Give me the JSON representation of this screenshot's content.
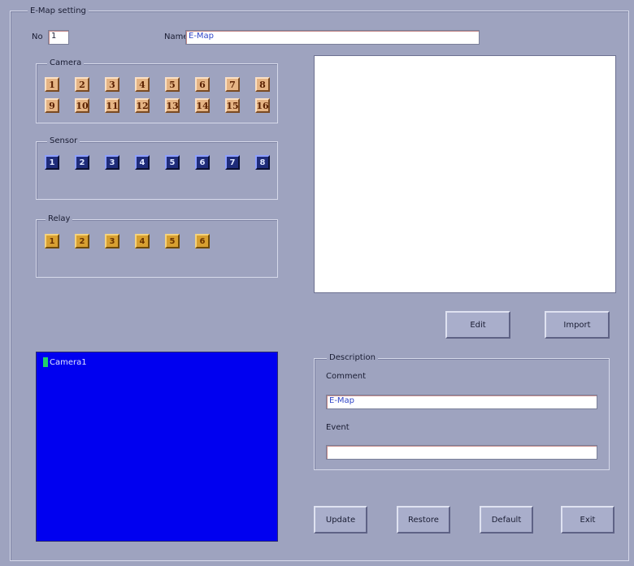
{
  "window": {
    "group_title": "E-Map setting"
  },
  "header": {
    "no_label": "No",
    "no_value": "1",
    "name_label": "Name",
    "name_value": "E-Map"
  },
  "camera": {
    "title": "Camera",
    "items": [
      "1",
      "2",
      "3",
      "4",
      "5",
      "6",
      "7",
      "8",
      "9",
      "10",
      "11",
      "12",
      "13",
      "14",
      "15",
      "16"
    ]
  },
  "sensor": {
    "title": "Sensor",
    "items": [
      "1",
      "2",
      "3",
      "4",
      "5",
      "6",
      "7",
      "8"
    ]
  },
  "relay": {
    "title": "Relay",
    "items": [
      "1",
      "2",
      "3",
      "4",
      "5",
      "6"
    ]
  },
  "map_buttons": {
    "edit": "Edit",
    "import": "Import"
  },
  "tree": {
    "items": [
      {
        "label": "Camera1",
        "icon": "camera-icon"
      }
    ]
  },
  "description": {
    "title": "Description",
    "comment_label": "Comment",
    "comment_value": "E-Map",
    "event_label": "Event",
    "event_value": ""
  },
  "footer": {
    "update": "Update",
    "restore": "Restore",
    "default": "Default",
    "exit": "Exit"
  },
  "colors": {
    "background": "#9ea3bf",
    "camera_tile": "#e5b484",
    "sensor_tile": "#1f2c7a",
    "relay_tile": "#d8a030",
    "tree_background": "#0000f0"
  }
}
